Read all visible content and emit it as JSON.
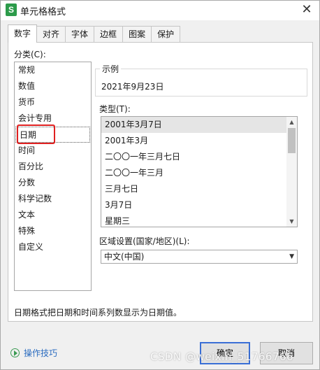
{
  "window": {
    "title": "单元格格式",
    "app_icon_letter": "S",
    "close_glyph": "✕"
  },
  "tabs": [
    {
      "label": "数字",
      "active": true
    },
    {
      "label": "对齐"
    },
    {
      "label": "字体"
    },
    {
      "label": "边框"
    },
    {
      "label": "图案"
    },
    {
      "label": "保护"
    }
  ],
  "category": {
    "label": "分类(C):",
    "items": [
      "常规",
      "数值",
      "货币",
      "会计专用",
      "日期",
      "时间",
      "百分比",
      "分数",
      "科学记数",
      "文本",
      "特殊",
      "自定义"
    ],
    "selected": "日期"
  },
  "sample": {
    "legend": "示例",
    "value": "2021年9月23日"
  },
  "type": {
    "label": "类型(T):",
    "items": [
      "2001年3月7日",
      "2001年3月",
      "二〇〇一年三月七日",
      "二〇〇一年三月",
      "三月七日",
      "3月7日",
      "星期三"
    ],
    "selected": "2001年3月7日"
  },
  "locale": {
    "label": "区域设置(国家/地区)(L):",
    "value": "中文(中国)"
  },
  "description": "日期格式把日期和时间系列数显示为日期值。",
  "footer": {
    "help_label": "操作技巧",
    "ok_label": "确定",
    "cancel_label": "取消"
  },
  "watermark": "CSDN @weixin_51766766",
  "colors": {
    "highlight_box": "#e02020",
    "app_icon": "#2c9b4a",
    "link": "#2a6bbf",
    "ok_border": "#3a6fd6"
  }
}
